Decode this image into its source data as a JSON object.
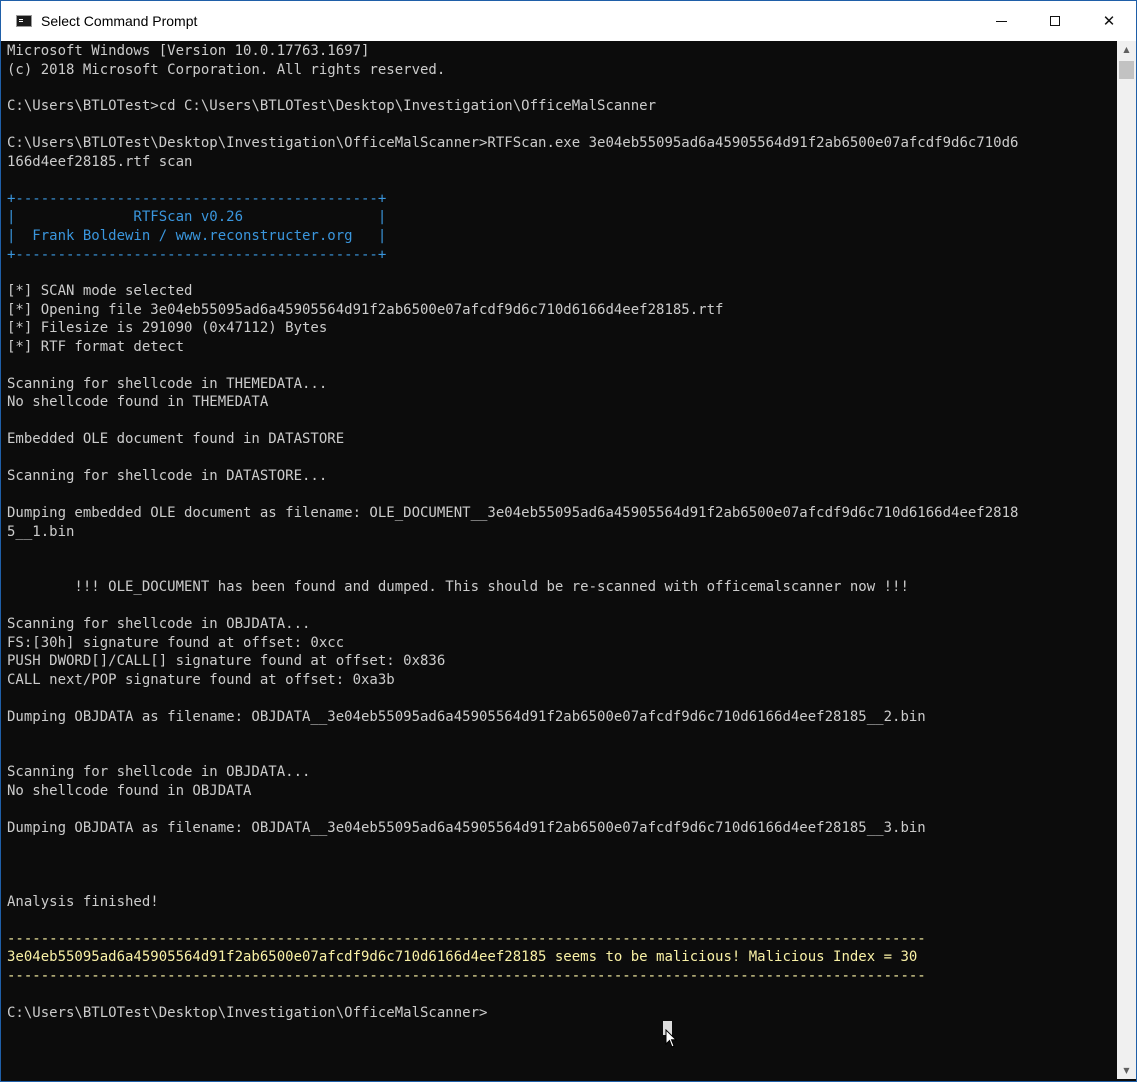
{
  "window": {
    "title": "Select Command Prompt",
    "minimize_label": "—",
    "maximize_label": "☐",
    "close_label": "✕"
  },
  "console": {
    "lines": [
      "Microsoft Windows [Version 10.0.17763.1697]",
      "(c) 2018 Microsoft Corporation. All rights reserved.",
      "C:\\Users\\BTLOTest>cd C:\\Users\\BTLOTest\\Desktop\\Investigation\\OfficeMalScanner",
      "C:\\Users\\BTLOTest\\Desktop\\Investigation\\OfficeMalScanner>RTFScan.exe 3e04eb55095ad6a45905564d91f2ab6500e07afcdf9d6c710d6",
      "166d4eef28185.rtf scan",
      "+-------------------------------------------+",
      "|              RTFScan v0.26                |",
      "|  Frank Boldewin / www.reconstructer.org   |",
      "+-------------------------------------------+",
      "[*] SCAN mode selected",
      "[*] Opening file 3e04eb55095ad6a45905564d91f2ab6500e07afcdf9d6c710d6166d4eef28185.rtf",
      "[*] Filesize is 291090 (0x47112) Bytes",
      "[*] RTF format detect",
      "Scanning for shellcode in THEMEDATA...",
      "No shellcode found in THEMEDATA",
      "Embedded OLE document found in DATASTORE",
      "Scanning for shellcode in DATASTORE...",
      "Dumping embedded OLE document as filename: OLE_DOCUMENT__3e04eb55095ad6a45905564d91f2ab6500e07afcdf9d6c710d6166d4eef2818",
      "5__1.bin",
      "        !!! OLE_DOCUMENT has been found and dumped. This should be re-scanned with officemalscanner now !!!",
      "Scanning for shellcode in OBJDATA...",
      "FS:[30h] signature found at offset: 0xcc",
      "PUSH DWORD[]/CALL[] signature found at offset: 0x836",
      "CALL next/POP signature found at offset: 0xa3b",
      "Dumping OBJDATA as filename: OBJDATA__3e04eb55095ad6a45905564d91f2ab6500e07afcdf9d6c710d6166d4eef28185__2.bin",
      "Scanning for shellcode in OBJDATA...",
      "No shellcode found in OBJDATA",
      "Dumping OBJDATA as filename: OBJDATA__3e04eb55095ad6a45905564d91f2ab6500e07afcdf9d6c710d6166d4eef28185__3.bin",
      "Analysis finished!",
      "-------------------------------------------------------------------------------------------------------------",
      "3e04eb55095ad6a45905564d91f2ab6500e07afcdf9d6c710d6166d4eef28185 seems to be malicious! Malicious Index = 30",
      "-------------------------------------------------------------------------------------------------------------",
      "C:\\Users\\BTLOTest\\Desktop\\Investigation\\OfficeMalScanner>"
    ]
  },
  "colors": {
    "background": "#0c0c0c",
    "text": "#cccccc",
    "banner": "#3a96dd",
    "result": "#f9f1a5"
  }
}
